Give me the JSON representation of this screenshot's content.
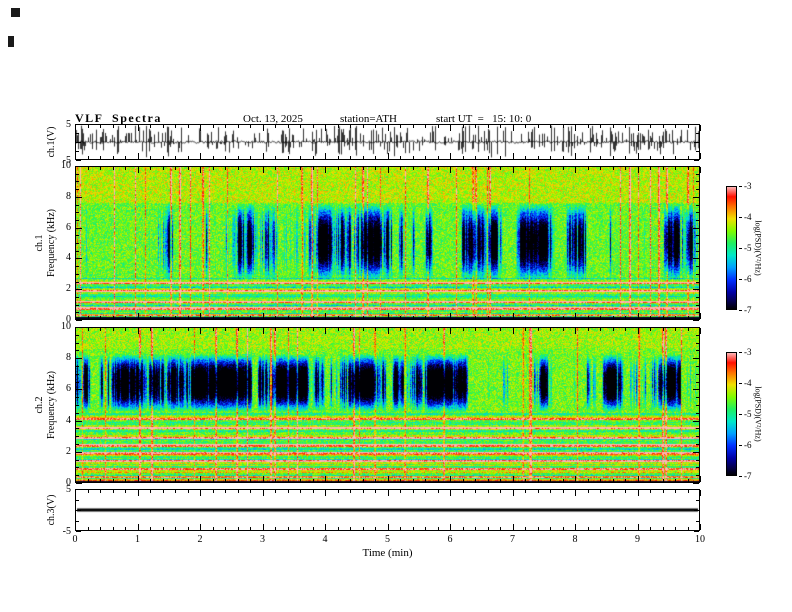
{
  "header": {
    "title": "VLF  Spectra",
    "date": "Oct. 13, 2025",
    "station": "station=ATH",
    "start_ut": "start UT  =   15: 10: 0"
  },
  "axis": {
    "wave1_label": "ch.1(V)",
    "wave3_label": "ch.3(V)",
    "spec1_line1": "ch.1",
    "spec1_line2": "Frequency  (kHz)",
    "spec2_line1": "ch.2",
    "spec2_line2": "Frequency  (kHz)",
    "x_tick_labels": [
      "0",
      "1",
      "2",
      "3",
      "4",
      "5",
      "6",
      "7",
      "8",
      "9",
      "10"
    ],
    "spec_y_tick_labels": [
      "10",
      "8",
      "6",
      "4",
      "2",
      "0"
    ],
    "wave_y_tick_labels": [
      "5",
      "-5"
    ],
    "colorbar_tick_labels": [
      "-3",
      "-4",
      "-5",
      "-6",
      "-7"
    ],
    "colorbar_label": "log(PSD)(V²/Hz)"
  },
  "time_axis": {
    "label": "Time  (min)",
    "ticks": [
      0,
      1,
      2,
      3,
      4,
      5,
      6,
      7,
      8,
      9,
      10
    ]
  },
  "colormap": [
    {
      "pos": 0.0,
      "color": "#000004"
    },
    {
      "pos": 0.06,
      "color": "#04004a"
    },
    {
      "pos": 0.14,
      "color": "#0000a8"
    },
    {
      "pos": 0.24,
      "color": "#0030ff"
    },
    {
      "pos": 0.34,
      "color": "#00a0ff"
    },
    {
      "pos": 0.44,
      "color": "#00e8c8"
    },
    {
      "pos": 0.54,
      "color": "#20f060"
    },
    {
      "pos": 0.64,
      "color": "#80fc00"
    },
    {
      "pos": 0.74,
      "color": "#f0e000"
    },
    {
      "pos": 0.84,
      "color": "#ff7000"
    },
    {
      "pos": 0.92,
      "color": "#ff1000"
    },
    {
      "pos": 1.0,
      "color": "#ffb6b6"
    }
  ],
  "chart_data": [
    {
      "id": "ch1_waveform",
      "type": "line",
      "ylabel": "ch.1(V)",
      "xlabel": "Time (min)",
      "xlim": [
        0,
        10
      ],
      "ylim": [
        -5,
        5
      ],
      "ytick_labels": [
        5,
        -5
      ],
      "description": "Raw ch.1 voltage versus time: a ~0 V baseline carrying dense impulsive sferic spikes of roughly 1 to 5 V in both polarities continuously over the full 10-minute record.",
      "synthesis": {
        "seed": 77,
        "noise": 0.35,
        "spike_prob": 0.42,
        "amp_lo": 0.8,
        "amp_hi": 4.6
      }
    },
    {
      "id": "ch1_spectrogram",
      "type": "heatmap",
      "ylabel": "ch.1 Frequency (kHz)",
      "xlim": [
        0,
        10
      ],
      "ylim": [
        0,
        10
      ],
      "yticks": [
        0,
        2,
        4,
        6,
        8,
        10
      ],
      "zlabel": "log(PSD)(V²/Hz)",
      "zlim": [
        -7,
        -3
      ],
      "legend_position": "right-colorbar",
      "grid": false,
      "description": "VLF spectrogram of ch.1 over 10 min: broadband green/yellow background near log PSD -4.5; clusters of vertical dark-blue fades (down to -7) mainly between ~2.5 and 7.5 kHz; frequent narrow bright red vertical streaks (~-3, sferics) spanning the whole band; quasi-horizontal banded structure with bright orange/red lines below ~2.7 kHz; nearly black band below ~0.2 kHz; slightly brighter yellow-green texture above ~7.6 kHz.",
      "synthesis": {
        "seed": 20251013,
        "base": -4.55,
        "noise": 0.45,
        "top_bright": {
          "from_khz": 7.6,
          "boost": 0.3
        },
        "fade_band": {
          "lo_khz": 2.5,
          "hi_khz": 7.6,
          "strength": 2.2,
          "walk": 0.9,
          "damp": 0.93
        },
        "stripe_region_khz": 2.7,
        "stripe_amp": 0.9,
        "bright_lines_khz": [
          0.35,
          0.75,
          1.15,
          1.9,
          2.4
        ],
        "line_boost": 1.3,
        "spike_prob": 0.055,
        "spike_boost": 1.6,
        "bottom_dark_khz": 0.18
      }
    },
    {
      "id": "ch2_spectrogram",
      "type": "heatmap",
      "ylabel": "ch.2 Frequency (kHz)",
      "xlim": [
        0,
        10
      ],
      "ylim": [
        0,
        10
      ],
      "yticks": [
        0,
        2,
        4,
        6,
        8,
        10
      ],
      "zlabel": "log(PSD)(V²/Hz)",
      "zlim": [
        -7,
        -3
      ],
      "legend_position": "right-colorbar",
      "grid": false,
      "description": "VLF spectrogram of ch.2 over the same 10 min: greener overall than ch.1; vertical dark-blue fades concentrated between ~4.5 and 8.3 kHz; many quasi-horizontal green/cyan bands with orange/red lines below ~4.5 kHz; the same bright red vertical sferic streaks; dark band below ~0.15 kHz.",
      "synthesis": {
        "seed": 1310,
        "base": -4.5,
        "noise": 0.45,
        "top_bright": {
          "from_khz": 8.6,
          "boost": 0.15
        },
        "fade_band": {
          "lo_khz": 4.5,
          "hi_khz": 8.3,
          "strength": 2.4,
          "walk": 0.9,
          "damp": 0.93
        },
        "stripe_region_khz": 4.5,
        "stripe_amp": 0.9,
        "bright_lines_khz": [
          0.4,
          0.9,
          1.4,
          1.9,
          2.4,
          2.9,
          3.5,
          4.1
        ],
        "line_boost": 1.3,
        "spike_prob": 0.05,
        "spike_boost": 1.6,
        "bottom_dark_khz": 0.15
      }
    },
    {
      "id": "ch3_waveform",
      "type": "line",
      "ylabel": "ch.3(V)",
      "xlabel": "Time (min)",
      "xlim": [
        0,
        10
      ],
      "ylim": [
        -5,
        5
      ],
      "ytick_labels": [
        5,
        -5
      ],
      "values_constant": 0,
      "description": "ch.3 voltage is a flat thick line at ~0 V for the entire 10-minute record (no signal on this channel).",
      "synthesis": {
        "value": 0,
        "thickness_px": 3
      }
    }
  ]
}
